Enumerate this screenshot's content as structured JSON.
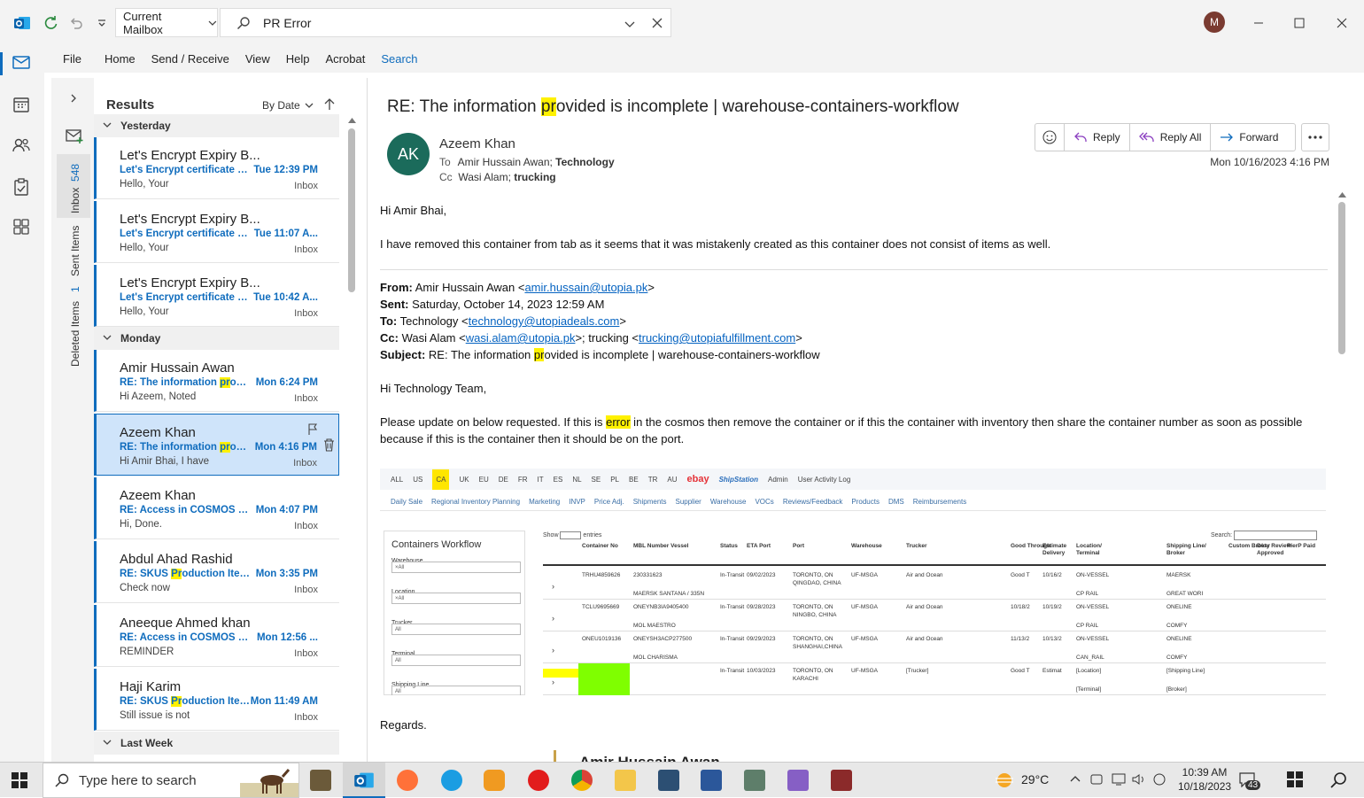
{
  "titlebar": {
    "mailbox": "Current Mailbox",
    "search_query": "PR Error",
    "avatar_initial": "M"
  },
  "menu": [
    "File",
    "Home",
    "Send / Receive",
    "View",
    "Help",
    "Acrobat",
    "Search"
  ],
  "folders": {
    "inbox_label": "Inbox",
    "inbox_count": "548",
    "sent_label": "Sent Items",
    "deleted_label": "Deleted Items",
    "deleted_count": "1"
  },
  "list": {
    "header": "Results",
    "sort": "By Date",
    "groups": {
      "yesterday": "Yesterday",
      "monday": "Monday",
      "last_week": "Last Week"
    },
    "messages": [
      {
        "from": "Let's Encrypt Expiry B...",
        "subject": "Let's Encrypt certificate ex...",
        "time": "Tue 12:39 PM",
        "preview": "Hello,  Your",
        "folder": "Inbox"
      },
      {
        "from": "Let's Encrypt Expiry B...",
        "subject": "Let's Encrypt certificate ex...",
        "time": "Tue 11:07 A...",
        "preview": "Hello,  Your",
        "folder": "Inbox"
      },
      {
        "from": "Let's Encrypt Expiry B...",
        "subject": "Let's Encrypt certificate ex...",
        "time": "Tue 10:42 A...",
        "preview": "Hello,  Your",
        "folder": "Inbox"
      },
      {
        "from": "Amir Hussain Awan",
        "subject_pre": "RE: The information ",
        "subject_hl": "pr",
        "subject_post": "ovid...",
        "time": "Mon 6:24 PM",
        "preview": "Hi Azeem,    Noted",
        "folder": "Inbox"
      },
      {
        "from": "Azeem Khan",
        "subject_pre": "RE: The information ",
        "subject_hl": "pr",
        "subject_post": "ovid...",
        "time": "Mon 4:16 PM",
        "preview": "Hi Amir Bhai,  I have",
        "folder": "Inbox"
      },
      {
        "from": "Azeem Khan",
        "subject_pre": "RE: Access in COSMOS for ",
        "subject_hl": "...",
        "subject_post": "",
        "time": "Mon 4:07 PM",
        "preview": "Hi,  Done.",
        "folder": "Inbox"
      },
      {
        "from": "Abdul Ahad Rashid",
        "subject_pre": "RE: SKUS ",
        "subject_hl": "Pr",
        "subject_post": "oduction Items",
        "time": "Mon 3:35 PM",
        "preview": "Check now",
        "folder": "Inbox"
      },
      {
        "from": "Aneeque Ahmed khan",
        "subject_pre": "RE: Access in COSMOS for ",
        "subject_hl": "...",
        "subject_post": "",
        "time": "Mon 12:56 ...",
        "preview": "REMINDER",
        "folder": "Inbox"
      },
      {
        "from": "Haji Karim",
        "subject_pre": "RE: SKUS ",
        "subject_hl": "Pr",
        "subject_post": "oduction Items",
        "time": "Mon 11:49 AM",
        "preview": "Still issue is not",
        "folder": "Inbox"
      }
    ]
  },
  "reading": {
    "subject_pre": "RE: The information ",
    "subject_hl": "pr",
    "subject_post": "ovided is incomplete | warehouse-containers-workflow",
    "avatar": "AK",
    "sender": "Azeem Khan",
    "to_label": "To",
    "to": "Amir Hussain Awan;",
    "to_bold": "Technology",
    "cc_label": "Cc",
    "cc": "Wasi Alam;",
    "cc_bold": "trucking",
    "actions": {
      "reply": "Reply",
      "reply_all": "Reply All",
      "forward": "Forward"
    },
    "date": "Mon 10/16/2023 4:16 PM",
    "greeting": "Hi Amir Bhai,",
    "line1": "I have removed this container from tab as it seems that it was mistakenly created as this container does not consist of items as well.",
    "fwd": {
      "from_label": "From:",
      "from_name": "Amir Hussain Awan <",
      "from_email": "amir.hussain@utopia.pk",
      "from_close": ">",
      "sent_label": "Sent:",
      "sent": "Saturday, October 14, 2023 12:59 AM",
      "to_label": "To:",
      "to_name": "Technology <",
      "to_email": "technology@utopiadeals.com",
      "to_close": ">",
      "cc_label": "Cc:",
      "cc_name": "Wasi Alam <",
      "cc_email": "wasi.alam@utopia.pk",
      "cc_mid": ">; trucking <",
      "cc_email2": "trucking@utopiafulfillment.com",
      "cc_close": ">",
      "subject_label": "Subject:",
      "subject_pre": "RE: The information ",
      "subject_hl": "pr",
      "subject_post": "ovided is incomplete | warehouse-containers-workflow"
    },
    "greeting2": "Hi Technology Team,",
    "para_pre": "Please update on below requested. If this is ",
    "para_hl": "error",
    "para_post": " in the cosmos then remove the container or if this the container with inventory then share the container number as soon as possible because if this is the container then it should be on the port.",
    "regards": "Regards.",
    "sig_name": "Amir Hussain Awan"
  },
  "embedded": {
    "nav": [
      "ALL",
      "US",
      "CA",
      "UK",
      "EU",
      "DE",
      "FR",
      "IT",
      "ES",
      "NL",
      "SE",
      "PL",
      "BE",
      "TR",
      "AU",
      "ebay",
      "ShipStation",
      "Admin",
      "User Activity Log"
    ],
    "subnav": [
      "Daily Sale",
      "Regional Inventory Planning",
      "Marketing",
      "INVP",
      "Price Adj.",
      "Shipments",
      "Supplier",
      "Warehouse",
      "VOCs",
      "Reviews/Feedback",
      "Products",
      "DMS",
      "Reimbursements"
    ],
    "panel_title": "Containers Workflow",
    "filters": [
      {
        "label": "Warehouse",
        "value": "×All"
      },
      {
        "label": "Location",
        "value": "×All"
      },
      {
        "label": "Trucker",
        "value": "All"
      },
      {
        "label": "Terminal",
        "value": "All"
      },
      {
        "label": "Shipping Line",
        "value": "All"
      }
    ],
    "show_label": "Show",
    "entries_label": "entries",
    "search_label": "Search:",
    "columns": [
      "Container No",
      "MBL Number Vessel",
      "Status",
      "ETA Port",
      "Port",
      "Warehouse",
      "Trucker",
      "Good Through",
      "Estimate Delivery",
      "Location/ Terminal",
      "Shipping Line/ Broker",
      "Custom Broker",
      "Duty Review Approved",
      "PierP Paid"
    ],
    "rows": [
      {
        "container": "TRHU4859626",
        "mbl": "230331623",
        "vessel": "MAERSK SANTANA / 335N",
        "status": "In-Transit",
        "eta": "09/02/2023",
        "port": "TORONTO, ON QINGDAO, CHINA",
        "warehouse": "UF-MSGA",
        "trucker": "Air and Ocean",
        "good": "Good T",
        "est": "10/16/2",
        "loc": "ON-VESSEL",
        "term": "CP RAIL",
        "line": "MAERSK",
        "broker": "GREAT WORI"
      },
      {
        "container": "TCLU9695669",
        "mbl": "ONEYNB3IA9405400",
        "vessel": "MOL MAESTRO",
        "status": "In-Transit",
        "eta": "09/28/2023",
        "port": "TORONTO, ON NINGBO, CHINA",
        "warehouse": "UF-MSGA",
        "trucker": "Air and Ocean",
        "good": "10/18/2",
        "est": "10/19/2",
        "loc": "ON-VESSEL",
        "term": "CP RAIL",
        "line": "ONELINE",
        "broker": "COMFY"
      },
      {
        "container": "ONEU1019136",
        "mbl": "ONEYSH3ACP277500",
        "vessel": "MOL CHARISMA",
        "status": "In-Transit",
        "eta": "09/29/2023",
        "port": "TORONTO, ON SHANGHAI,CHINA",
        "warehouse": "UF-MSGA",
        "trucker": "Air and Ocean",
        "good": "11/13/2",
        "est": "10/13/2",
        "loc": "ON-VESSEL",
        "term": "CAN_RAIL",
        "line": "ONELINE",
        "broker": "COMFY"
      },
      {
        "container": "",
        "mbl": "",
        "vessel": "",
        "status": "In-Transit",
        "eta": "10/03/2023",
        "port": "TORONTO, ON KARACHI",
        "warehouse": "UF-MSGA",
        "trucker": "[Trucker]",
        "good": "Good T",
        "est": "Estimat",
        "loc": "[Location]",
        "term": "[Terminal]",
        "line": "[Shipping Line]",
        "broker": "[Broker]"
      }
    ]
  },
  "taskbar": {
    "search_placeholder": "Type here to search",
    "weather": "29°C",
    "time": "10:39 AM",
    "date": "10/18/2023",
    "notifications": "43"
  },
  "colors": {
    "accent": "#0f6cbd",
    "highlight": "#fff100",
    "avatar_ak": "#1b6b5b",
    "avatar_m": "#7a3b31"
  }
}
